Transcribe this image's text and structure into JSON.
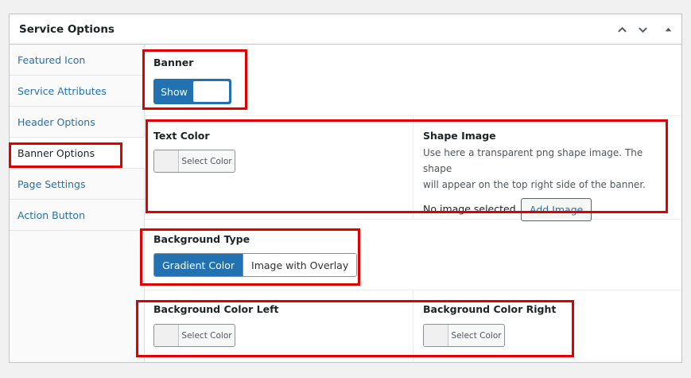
{
  "panel": {
    "title": "Service Options"
  },
  "tabs": [
    {
      "label": "Featured Icon"
    },
    {
      "label": "Service Attributes"
    },
    {
      "label": "Header Options"
    },
    {
      "label": "Banner Options"
    },
    {
      "label": "Page Settings"
    },
    {
      "label": "Action Button"
    }
  ],
  "banner": {
    "label": "Banner",
    "toggle_label": "Show"
  },
  "text_color": {
    "label": "Text Color",
    "button": "Select Color"
  },
  "shape_image": {
    "label": "Shape Image",
    "desc_line1": "Use here a transparent png shape image. The shape",
    "desc_line2": "will appear on the top right side of the banner.",
    "status": "No image selected",
    "button": "Add Image"
  },
  "background_type": {
    "label": "Background Type",
    "options": [
      "Gradient Color",
      "Image with Overlay"
    ],
    "selected": "Gradient Color"
  },
  "bg_color_left": {
    "label": "Background Color Left",
    "button": "Select Color"
  },
  "bg_color_right": {
    "label": "Background Color Right",
    "button": "Select Color"
  },
  "colors": {
    "accent": "#2271b1",
    "highlight": "#e10000"
  }
}
